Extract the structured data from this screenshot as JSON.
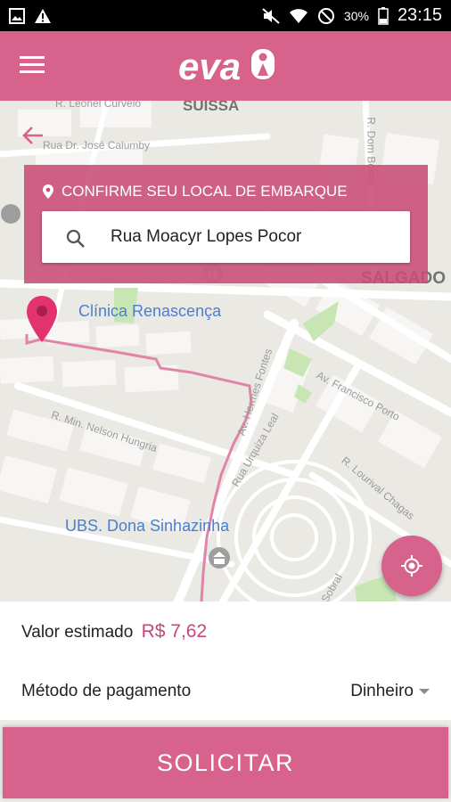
{
  "status_bar": {
    "battery_percent": "30%",
    "time": "23:15",
    "icons": [
      "image-icon",
      "warning-icon",
      "mute-icon",
      "wifi-icon",
      "do-not-disturb-icon",
      "battery-icon"
    ]
  },
  "app": {
    "logo_text": "eva",
    "accent_color": "#d7628b",
    "price_color": "#c9457a"
  },
  "map": {
    "street_labels": {
      "leonel": "R. Leonel Curvelo",
      "calumby": "Rua Dr. José Calumby",
      "dom_bosco": "R. Dom Bosco",
      "nelson": "R. Min. Nelson Hungria",
      "hermes": "Av. Hermes Fontes",
      "francisco": "Av. Francisco Porto",
      "urquiza": "Rua Urquiza Leal",
      "lourival": "R. Lourival Chagas",
      "sobral": "Sobral"
    },
    "area_labels": {
      "suissa": "SUISSA",
      "salgado": "SALGADO"
    },
    "poi_labels": {
      "clinica": "Clínica Renascença",
      "ubs": "UBS. Dona Sinhazinha"
    }
  },
  "confirm_panel": {
    "title": "CONFIRME SEU LOCAL DE EMBARQUE",
    "search_value": "Rua Moacyr Lopes Pocor"
  },
  "bottom_panel": {
    "fare_label": "Valor estimado",
    "fare_value": "R$ 7,62",
    "payment_label": "Método de pagamento",
    "payment_value": "Dinheiro"
  },
  "request_button": {
    "label": "SOLICITAR"
  }
}
